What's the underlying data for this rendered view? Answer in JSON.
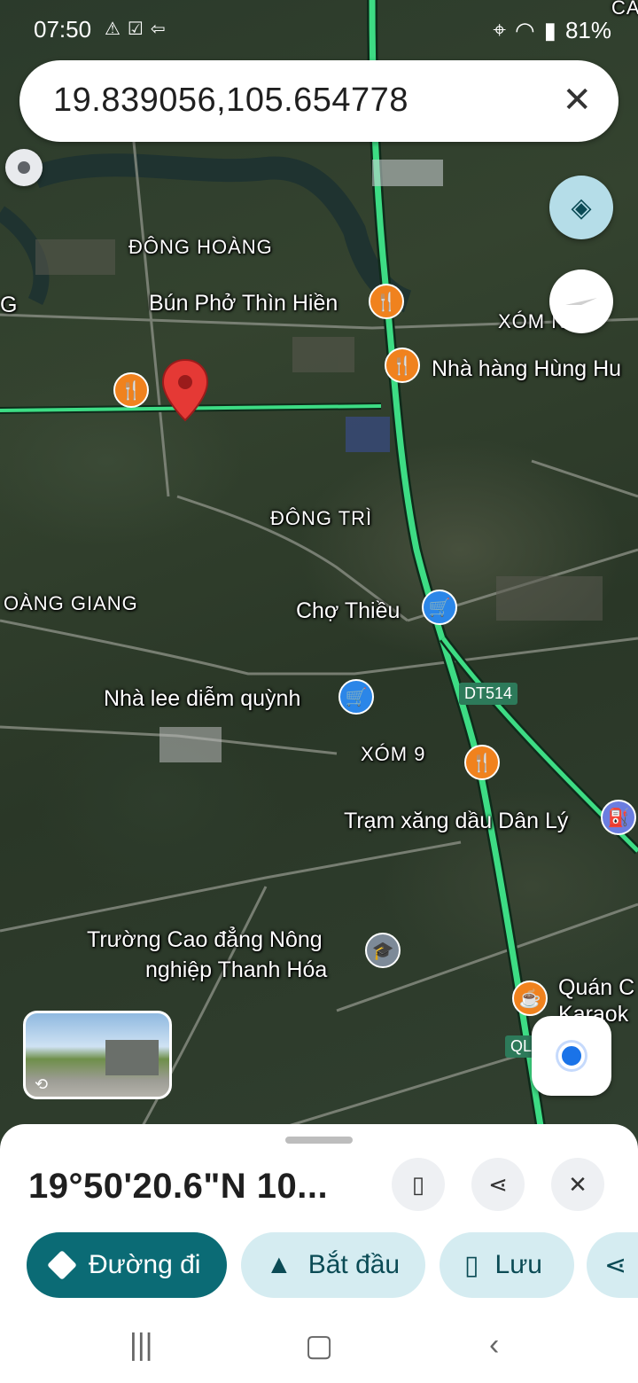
{
  "status_bar": {
    "time": "07:50",
    "battery": "81%"
  },
  "search": {
    "query": "19.839056,105.654778"
  },
  "map_labels": {
    "dong_hoang": "ĐÔNG HOÀNG",
    "g_partial": "G",
    "bun_pho": "Bún Phở Thìn Hiền",
    "xom_partial": "XÓM  NH",
    "nha_hang": "Nhà hàng Hùng Hu",
    "dong_tri": "ĐÔNG TRÌ",
    "hoang_giang": "OÀNG GIANG",
    "cho_thieu": "Chợ Thiều",
    "nha_lee": "Nhà lee diễm quỳnh",
    "dt514": "DT514",
    "xom9": "XÓM 9",
    "tram_xang": "Trạm xăng dầu Dân Lý",
    "truong1": "Trường Cao đẳng Nông",
    "truong2": "nghiệp Thanh Hóa",
    "quan1": "Quán C",
    "quan2": "Karaok",
    "ql": "QL4",
    "ca_partial": "CA"
  },
  "sheet": {
    "coords": "19°50'20.6\"N 10...",
    "actions": {
      "directions": "Đường đi",
      "start": "Bắt đầu",
      "save": "Lưu"
    }
  },
  "icons": {
    "layers": "layers-icon",
    "compass": "compass-icon",
    "location": "my-location-icon"
  },
  "colors": {
    "primary": "#0b6b75",
    "secondary": "#d5ecf1",
    "pin": "#e53935",
    "route": "#3ddc84"
  }
}
